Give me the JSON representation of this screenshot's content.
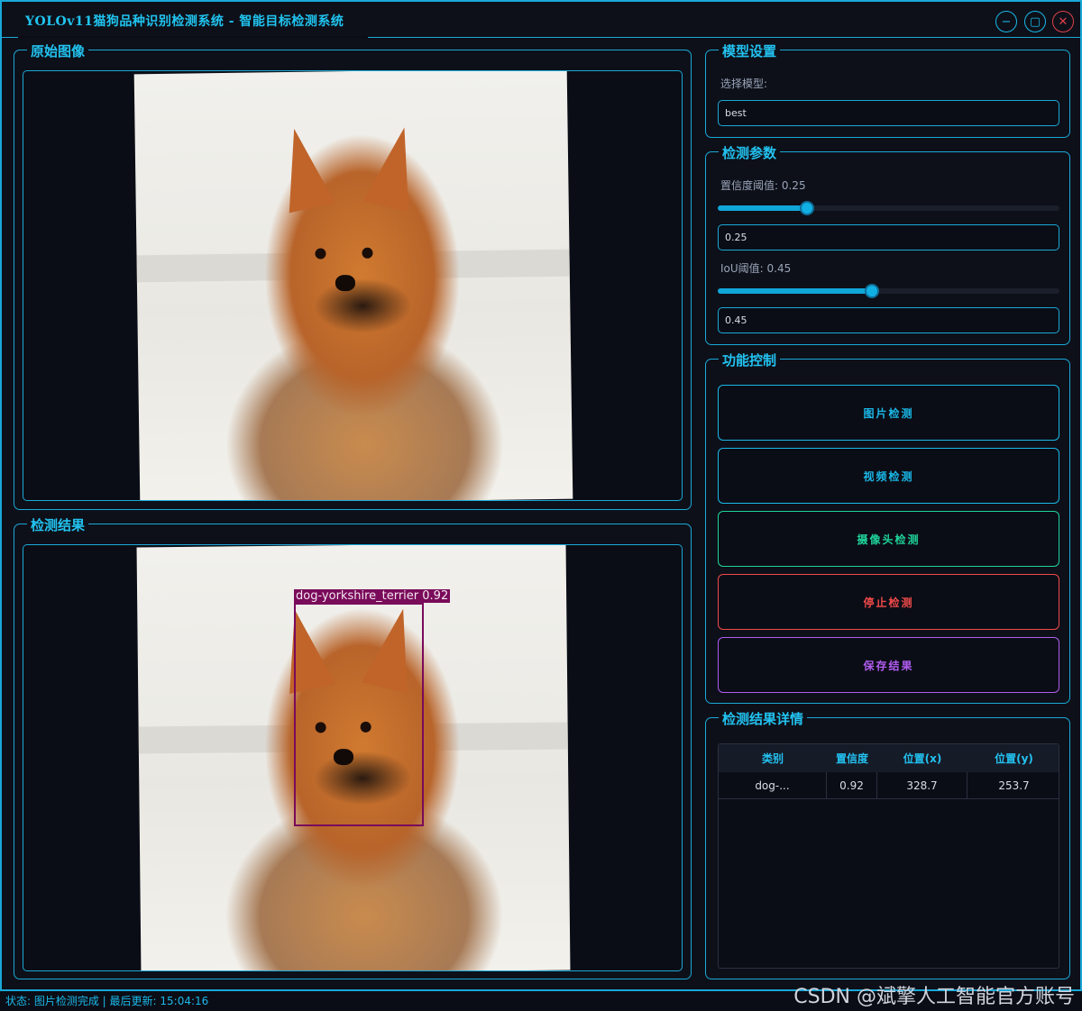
{
  "window": {
    "title": "YOLOv11猫狗品种识别检测系统 - 智能目标检测系统",
    "minimize_icon": "minimize-icon",
    "maximize_icon": "maximize-icon",
    "close_icon": "close-icon"
  },
  "original_panel": {
    "title": "原始图像"
  },
  "result_panel": {
    "title": "检测结果",
    "detection_label": "dog-yorkshire_terrier 0.92"
  },
  "model_settings": {
    "title": "模型设置",
    "select_label": "选择模型:",
    "selected_model": "best"
  },
  "detection_params": {
    "title": "检测参数",
    "confidence_label": "置信度阈值: 0.25",
    "confidence_value": "0.25",
    "confidence_fraction": 0.25,
    "iou_label": "IoU阈值: 0.45",
    "iou_value": "0.45",
    "iou_fraction": 0.45
  },
  "controls": {
    "title": "功能控制",
    "image_detect": "图片检测",
    "video_detect": "视频检测",
    "camera_detect": "摄像头检测",
    "stop_detect": "停止检测",
    "save_results": "保存结果",
    "colors": {
      "primary": "#1ab8e8",
      "camera": "#1fd39a",
      "stop": "#f04a4a",
      "save": "#b05cf0"
    }
  },
  "results_table": {
    "title": "检测结果详情",
    "headers": [
      "类别",
      "置信度",
      "位置(x)",
      "位置(y)"
    ],
    "rows": [
      [
        "dog-...",
        "0.92",
        "328.7",
        "253.7"
      ]
    ]
  },
  "status": {
    "text": "状态: 图片检测完成 | 最后更新: 15:04:16"
  },
  "watermark": "CSDN @斌擎人工智能官方账号"
}
